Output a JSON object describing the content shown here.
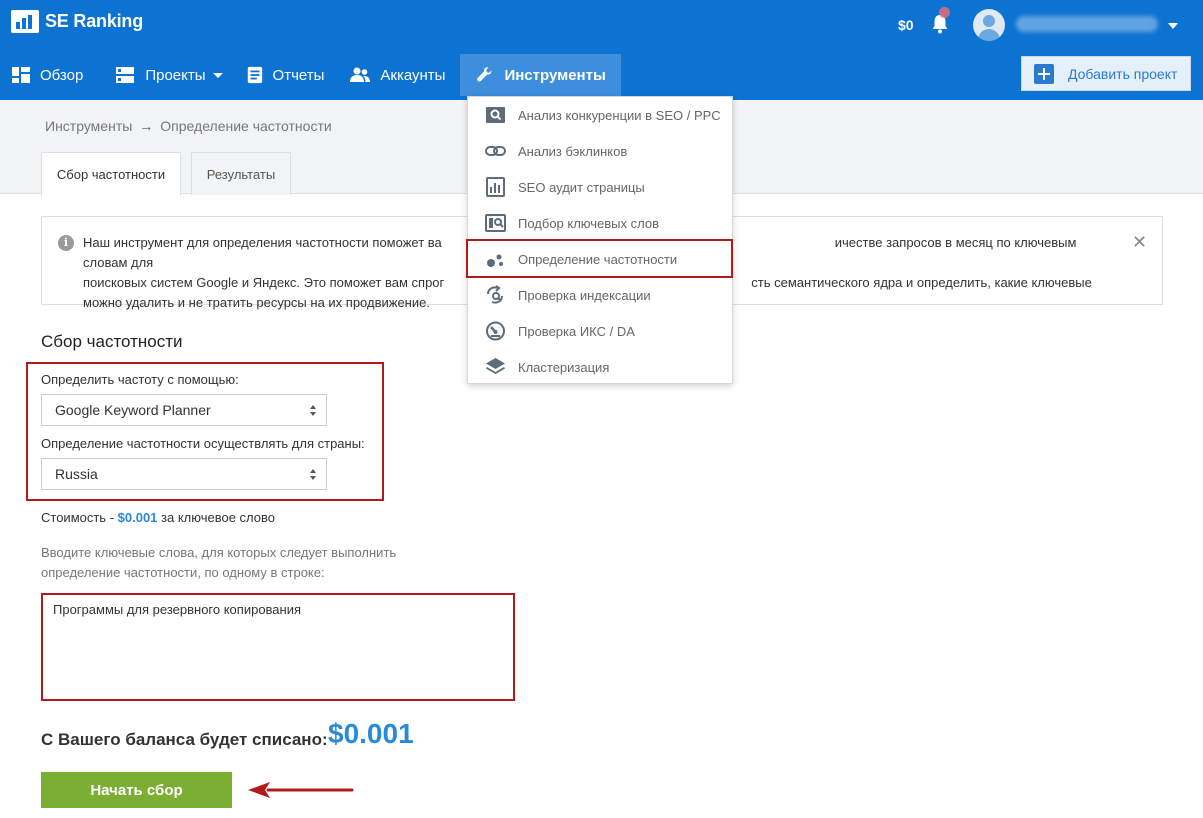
{
  "header": {
    "brand": "SE Ranking",
    "balance": "$0",
    "add_project": "Добавить проект",
    "colors": {
      "bar": "#0d73d3",
      "active": "#3d8fde",
      "accent": "#2a8ad8",
      "button": "#7cae34",
      "highlight": "#b21a1a"
    }
  },
  "nav": {
    "items": [
      {
        "label": "Обзор",
        "icon": "dashboard-icon"
      },
      {
        "label": "Проекты",
        "icon": "projects-icon"
      },
      {
        "label": "Отчеты",
        "icon": "reports-icon"
      },
      {
        "label": "Аккаунты",
        "icon": "accounts-icon"
      },
      {
        "label": "Инструменты",
        "icon": "wrench-icon"
      }
    ]
  },
  "breadcrumb": {
    "parent": "Инструменты",
    "separator": "→",
    "current": "Определение частотности"
  },
  "tabs": [
    "Сбор частотности",
    "Результаты"
  ],
  "info": {
    "text_line1_left": "Наш инструмент для определения частотности поможет ва",
    "text_line1_right": "ичестве запросов в месяц по ключевым словам для",
    "text_line2_left": "поисковых систем Google и Яндекс. Это поможет вам спрог",
    "text_line2_right": "сть семантического ядра и определить, какие ключевые",
    "text_line3": "можно удалить и не тратить ресурсы на их продвижение."
  },
  "form": {
    "title": "Сбор частотности",
    "method_label": "Определить частоту с помощью:",
    "method_value": "Google Keyword Planner",
    "country_label": "Определение частотности осуществлять для страны:",
    "country_value": "Russia",
    "cost_prefix": "Стоимость - ",
    "cost_price": "$0.001",
    "cost_suffix": " за ключевое слово",
    "keywords_hint": "Вводите ключевые слова, для которых следует выполнить определение частотности, по одному в строке:",
    "keywords_value": "Программы для резервного копирования",
    "charge_label": "С Вашего баланса будет списано:",
    "charge_amount": "$0.001",
    "start_button": "Начать сбор"
  },
  "tools_menu": {
    "items": [
      {
        "label": "Анализ конкуренции в SEO / PPC",
        "icon": "search-icon"
      },
      {
        "label": "Анализ бэклинков",
        "icon": "link-icon"
      },
      {
        "label": "SEO аудит страницы",
        "icon": "bar-chart-icon"
      },
      {
        "label": "Подбор ключевых слов",
        "icon": "keyword-search-icon"
      },
      {
        "label": "Определение частотности",
        "icon": "bubbles-icon",
        "selected": true
      },
      {
        "label": "Проверка индексации",
        "icon": "refresh-search-icon"
      },
      {
        "label": "Проверка ИКС / DA",
        "icon": "gauge-icon"
      },
      {
        "label": "Кластеризация",
        "icon": "layers-icon"
      }
    ]
  }
}
